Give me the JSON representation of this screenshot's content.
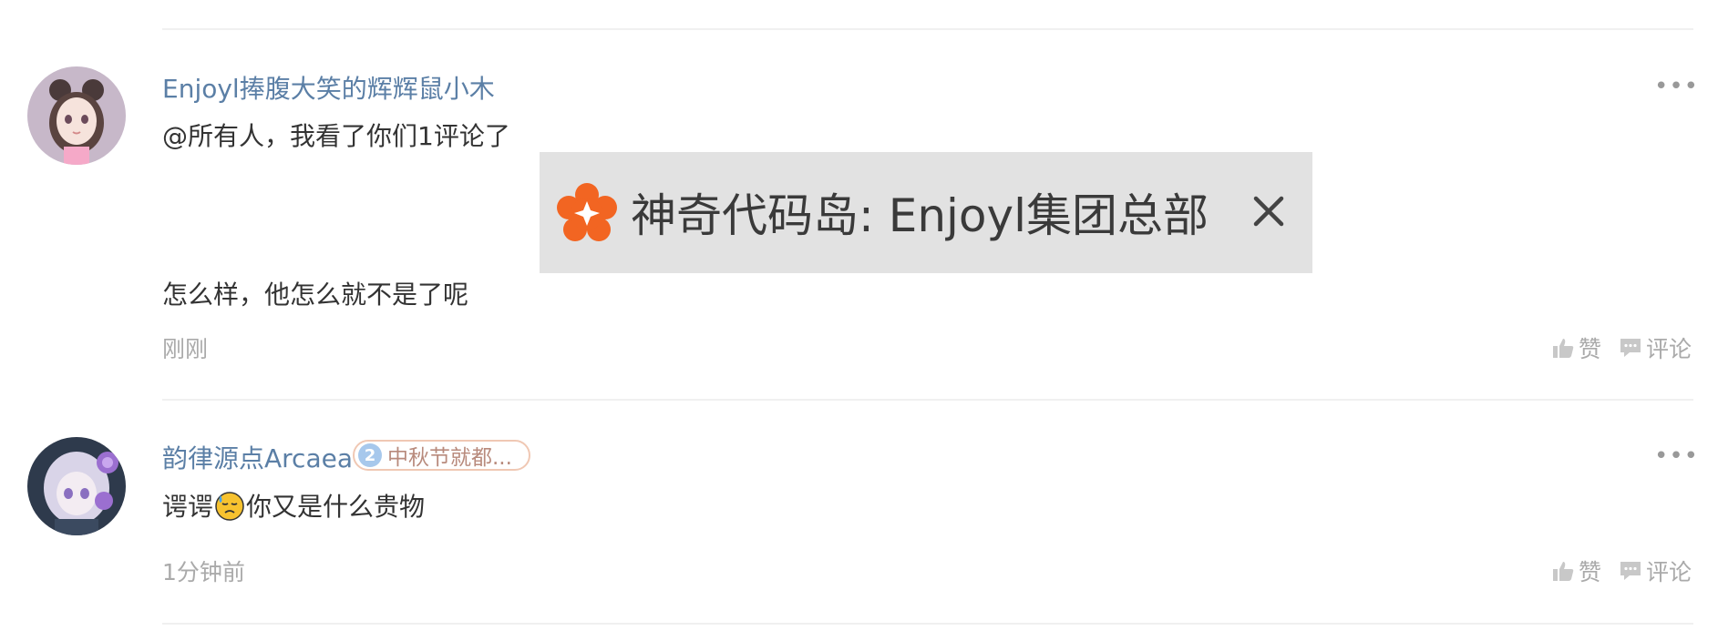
{
  "comments": [
    {
      "username": "Enjoyl捧腹大笑的辉辉鼠小木",
      "line1": "@所有人，我看了你们1评论了",
      "line2": "怎么样，他怎么就不是了呢",
      "time": "刚刚",
      "like_label": "赞",
      "comment_label": "评论",
      "more": "•••"
    },
    {
      "username": "韵律源点Arcaea",
      "badge_level": "2",
      "badge_text": "中秋节就都...",
      "text_before_emoji": "谔谔",
      "emoji": "sweat-face-emoji",
      "text_after_emoji": "你又是什么贵物",
      "time": "1分钟前",
      "like_label": "赞",
      "comment_label": "评论",
      "more": "•••"
    }
  ],
  "toast": {
    "text": "神奇代码岛: Enjoyl集团总部",
    "logo_icon": "star-burst-logo-icon",
    "close_icon": "close-icon",
    "background": "#e2e2e2"
  },
  "colors": {
    "username": "#5b7fa6",
    "secondary": "#aaaaaa",
    "logo_orange": "#f26522"
  }
}
